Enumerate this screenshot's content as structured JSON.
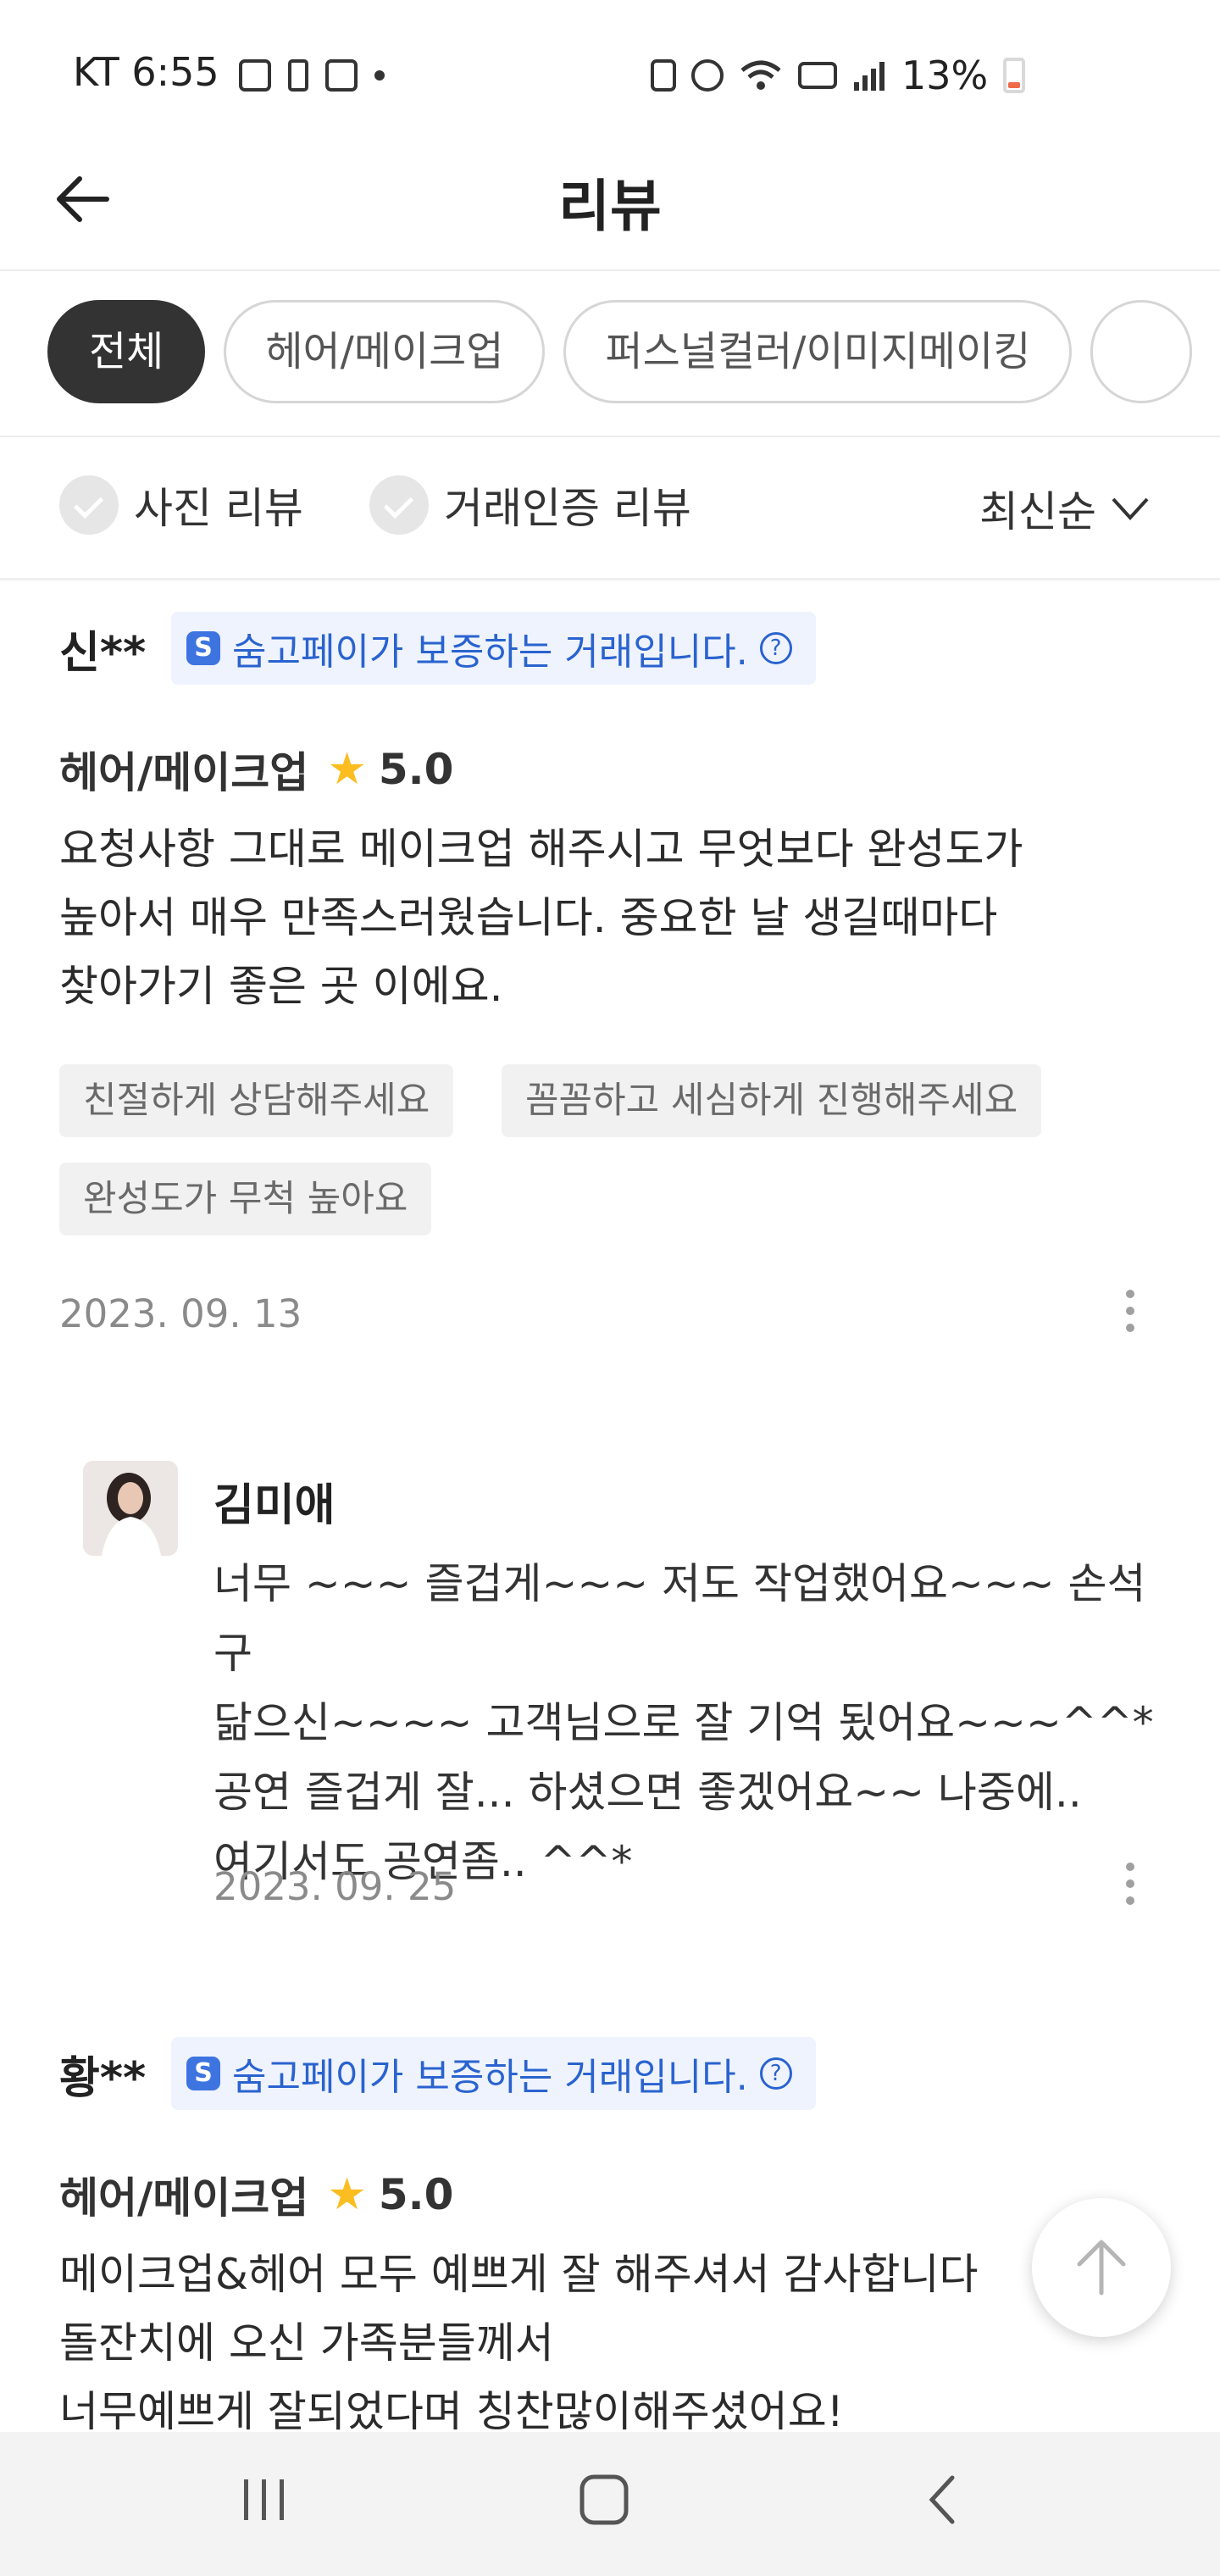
{
  "status_bar": {
    "carrier_time": "KT 6:55",
    "battery_pct": "13%"
  },
  "header": {
    "title": "리뷰"
  },
  "categories": [
    {
      "label": "전체",
      "active": true
    },
    {
      "label": "헤어/메이크업",
      "active": false
    },
    {
      "label": "퍼스널컬러/이미지메이킹",
      "active": false
    }
  ],
  "filters": {
    "photo_review": "사진 리뷰",
    "verified_review": "거래인증 리뷰",
    "sort": "최신순"
  },
  "reviews": [
    {
      "reviewer": "신**",
      "badge": "숨고페이가 보증하는 거래입니다.",
      "badge_logo": "S",
      "service": "헤어/메이크업",
      "rating": "5.0",
      "text": "요청사항 그대로 메이크업 해주시고 무엇보다 완성도가\n높아서 매우 만족스러웠습니다. 중요한 날 생길때마다\n찾아가기 좋은 곳 이에요.",
      "tags": [
        "친절하게 상담해주세요",
        "꼼꼼하고 세심하게 진행해주세요",
        "완성도가 무척 높아요"
      ],
      "date": "2023. 09. 13",
      "reply": {
        "name": "김미애",
        "text": "너무 ~~~ 즐겁게~~~ 저도 작업했어요~~~ 손석구\n닮으신~~~~ 고객님으로 잘 기억 됬어요~~~^^*\n공연 즐겁게 잘... 하셨으면 좋겠어요~~ 나중에..\n여기서도 공연좀.. ^^*",
        "date": "2023. 09. 25"
      }
    },
    {
      "reviewer": "황**",
      "badge": "숨고페이가 보증하는 거래입니다.",
      "badge_logo": "S",
      "service": "헤어/메이크업",
      "rating": "5.0",
      "text": "메이크업&헤어 모두 예쁘게 잘 해주셔서 감사합니다\n돌잔치에 오신 가족분들께서\n너무예쁘게 잘되었다며 칭찬많이해주셨어요!"
    }
  ],
  "icons": {
    "back": "arrow-left-icon",
    "star": "★",
    "help": "?",
    "scroll_top": "arrow-up-icon"
  },
  "colors": {
    "accent_blue": "#2a63cf",
    "badge_bg": "#eef3fd",
    "star": "#fbbd20",
    "active_chip": "#333333"
  }
}
